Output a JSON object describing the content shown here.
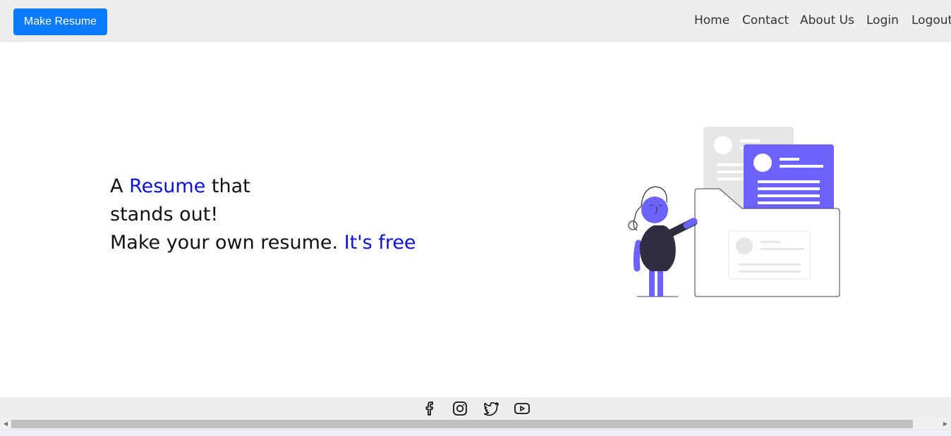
{
  "navbar": {
    "cta_label": "Make Resume",
    "links": [
      "Home",
      "Contact",
      "About Us",
      "Login",
      "Logout"
    ]
  },
  "hero": {
    "line1_prefix": "A ",
    "line1_accent": "Resume",
    "line1_suffix": " that",
    "line2": "stands out!",
    "line3_prefix": "Make your own resume. ",
    "line3_accent": "It's free"
  },
  "footer": {
    "social_icons": [
      "facebook-icon",
      "instagram-icon",
      "twitter-icon",
      "youtube-icon"
    ]
  },
  "colors": {
    "brand_button": "#0a7bff",
    "accent_text": "#0b10d6",
    "illustration_primary": "#6c63ff",
    "illustration_dark": "#2f2e41"
  }
}
